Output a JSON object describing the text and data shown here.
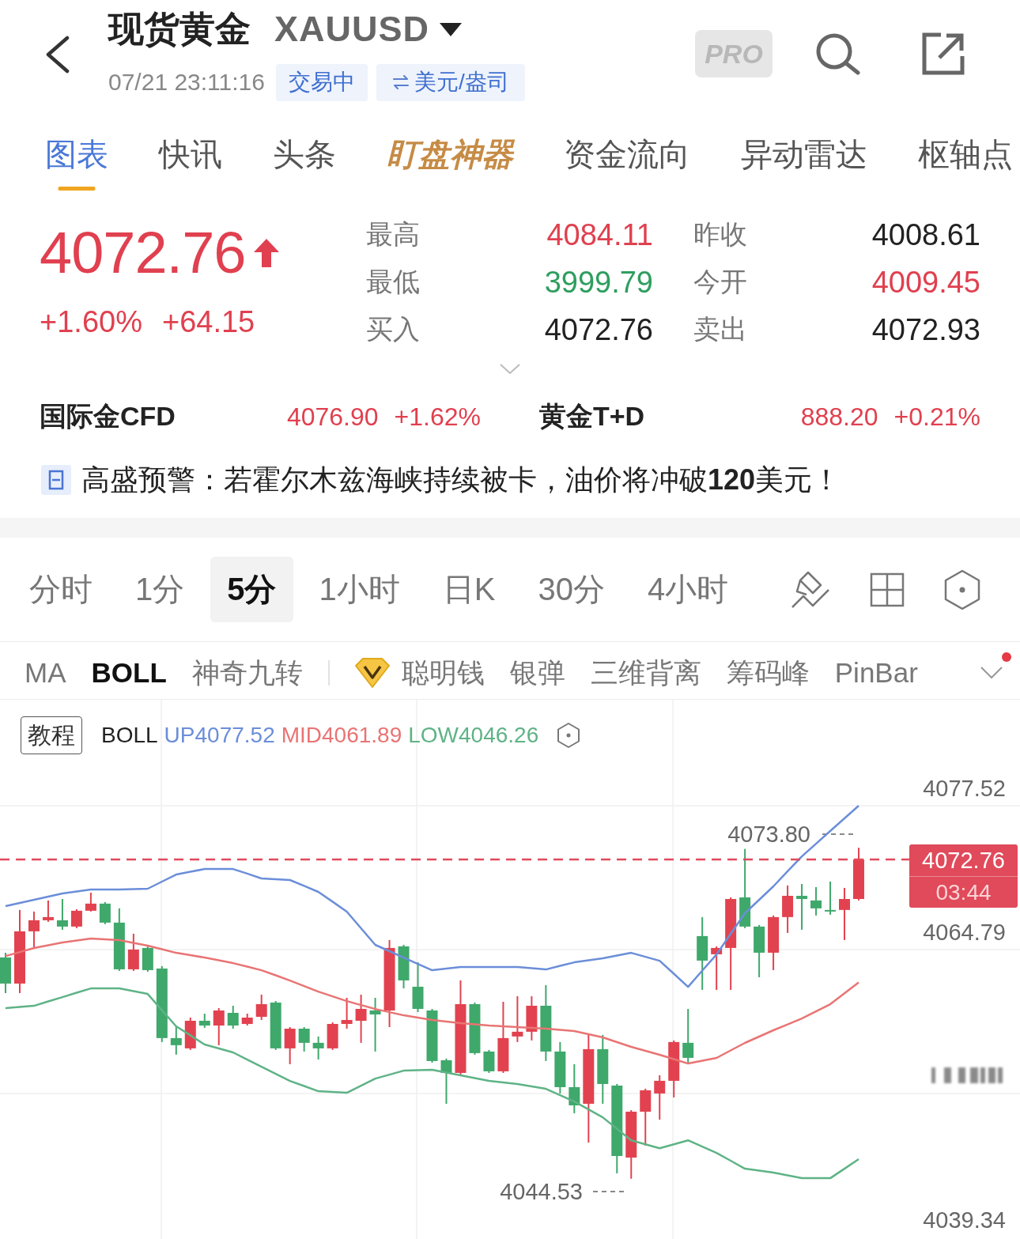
{
  "header": {
    "title": "现货黄金",
    "symbol": "XAUUSD",
    "time": "07/21 23:11:16",
    "badges": [
      {
        "kind": "status",
        "text": "交易中"
      },
      {
        "kind": "unit",
        "text": "美元/盎司"
      }
    ],
    "pro_label": "PRO"
  },
  "tabs": [
    {
      "label": "图表",
      "selected": true,
      "kind": "plain"
    },
    {
      "label": "快讯",
      "selected": false,
      "kind": "plain"
    },
    {
      "label": "头条",
      "selected": false,
      "kind": "plain"
    },
    {
      "label": "盯盘神器",
      "selected": false,
      "kind": "featured"
    },
    {
      "label": "资金流向",
      "selected": false,
      "kind": "plain"
    },
    {
      "label": "异动雷达",
      "selected": false,
      "kind": "plain"
    },
    {
      "label": "枢轴点",
      "selected": false,
      "kind": "plain"
    }
  ],
  "quote": {
    "price": "4072.76",
    "rising": true,
    "change_percent": "+1.60%",
    "change": "+64.15",
    "stats": [
      {
        "label": "最高",
        "value": "4084.11",
        "color": "#e0404f"
      },
      {
        "label": "昨收",
        "value": "4008.61",
        "color": "#222222"
      },
      {
        "label": "最低",
        "value": "3999.79",
        "color": "#2f9e5f"
      },
      {
        "label": "今开",
        "value": "4009.45",
        "color": "#e0404f"
      },
      {
        "label": "买入",
        "value": "4072.76",
        "color": "#222222"
      },
      {
        "label": "卖出",
        "value": "4072.93",
        "color": "#222222"
      }
    ]
  },
  "related": [
    {
      "name": "国际金CFD",
      "price": "4076.90",
      "change": "+1.62%",
      "color": "#e0404f"
    },
    {
      "name": "黄金T+D",
      "price": "888.20",
      "change": "+0.21%",
      "color": "#e0404f"
    }
  ],
  "news": {
    "text": "高盛预警：若霍尔木兹海峡持续被卡，油价将冲破**120**美元！"
  },
  "timeframes": [
    {
      "label": "分时",
      "selected": false
    },
    {
      "label": "1分",
      "selected": false
    },
    {
      "label": "5分",
      "selected": true
    },
    {
      "label": "1小时",
      "selected": false
    },
    {
      "label": "日K",
      "selected": false
    },
    {
      "label": "30分",
      "selected": false
    },
    {
      "label": "4小时",
      "selected": false
    }
  ],
  "indicators": {
    "basic": [
      {
        "label": "MA",
        "selected": false
      },
      {
        "label": "BOLL",
        "selected": true
      },
      {
        "label": "神奇九转",
        "selected": false
      }
    ],
    "premium": [
      {
        "label": "聪明钱",
        "selected": false
      },
      {
        "label": "银弹",
        "selected": false
      },
      {
        "label": "三维背离",
        "selected": false
      },
      {
        "label": "筹码峰",
        "selected": false
      },
      {
        "label": "PinBar",
        "selected": false
      }
    ],
    "more_alert": true
  },
  "chart": {
    "tutorial_label": "教程",
    "countdown": "03:44",
    "candles": {
      "chart_data": {
        "type": "candlestick",
        "grid": true,
        "ohlc": [
          [
            4064.1,
            4064.52,
            4060.95,
            4061.79
          ],
          [
            4061.79,
            4068.3,
            4060.95,
            4066.41
          ],
          [
            4066.41,
            4068.16,
            4064.94,
            4067.39
          ],
          [
            4067.39,
            4069.14,
            4067.25,
            4067.67
          ],
          [
            4067.39,
            4069.27,
            4066.55,
            4066.83
          ],
          [
            4066.83,
            4068.37,
            4066.69,
            4068.23
          ],
          [
            4068.23,
            4069.83,
            4068.16,
            4068.86
          ],
          [
            4068.86,
            4069.0,
            4067.04,
            4067.18
          ],
          [
            4067.18,
            4068.44,
            4062.91,
            4063.05
          ],
          [
            4063.05,
            4066.2,
            4062.91,
            4064.8
          ],
          [
            4064.94,
            4065.08,
            4062.84,
            4062.98
          ],
          [
            4063.12,
            4063.33,
            4056.62,
            4056.97
          ],
          [
            4056.97,
            4058.01,
            4055.5,
            4056.34
          ],
          [
            4056.06,
            4058.78,
            4055.92,
            4058.5
          ],
          [
            4058.5,
            4059.13,
            4057.87,
            4058.08
          ],
          [
            4058.08,
            4059.62,
            4056.34,
            4059.41
          ],
          [
            4059.2,
            4059.83,
            4057.8,
            4058.08
          ],
          [
            4058.22,
            4059.13,
            4058.08,
            4058.78
          ],
          [
            4058.85,
            4060.81,
            4058.57,
            4059.97
          ],
          [
            4060.11,
            4060.25,
            4055.92,
            4056.06
          ],
          [
            4056.06,
            4057.94,
            4054.66,
            4057.8
          ],
          [
            4057.8,
            4057.94,
            4055.78,
            4056.55
          ],
          [
            4056.55,
            4057.11,
            4055.08,
            4056.06
          ],
          [
            4056.06,
            4058.36,
            4055.92,
            4058.22
          ],
          [
            4058.22,
            4060.53,
            4057.8,
            4058.57
          ],
          [
            4058.5,
            4060.81,
            4056.55,
            4059.55
          ],
          [
            4059.41,
            4060.53,
            4055.78,
            4059.06
          ],
          [
            4059.41,
            4065.64,
            4057.94,
            4064.94
          ],
          [
            4065.08,
            4065.22,
            4061.37,
            4062.07
          ],
          [
            4061.51,
            4063.68,
            4059.27,
            4059.55
          ],
          [
            4059.41,
            4059.55,
            4054.8,
            4054.94
          ],
          [
            4055.01,
            4055.15,
            4051.16,
            4053.89
          ],
          [
            4053.89,
            4062.07,
            4053.75,
            4059.97
          ],
          [
            4059.97,
            4060.11,
            4055.5,
            4055.64
          ],
          [
            4055.78,
            4055.92,
            4053.89,
            4054.03
          ],
          [
            4054.03,
            4060.18,
            4053.89,
            4056.97
          ],
          [
            4057.11,
            4060.67,
            4056.62,
            4057.53
          ],
          [
            4057.53,
            4060.67,
            4056.76,
            4059.83
          ],
          [
            4059.83,
            4061.65,
            4054.94,
            4055.78
          ],
          [
            4055.78,
            4056.62,
            4052.07,
            4052.63
          ],
          [
            4052.63,
            4054.66,
            4050.32,
            4051.02
          ],
          [
            4051.16,
            4057.25,
            4047.73,
            4055.99
          ],
          [
            4055.99,
            4057.25,
            4051.16,
            4052.91
          ],
          [
            4052.77,
            4052.91,
            4045.01,
            4046.54
          ],
          [
            4046.4,
            4050.6,
            4044.53,
            4050.46
          ],
          [
            4050.46,
            4052.49,
            4047.45,
            4052.35
          ],
          [
            4052.07,
            4053.68,
            4049.76,
            4053.19
          ],
          [
            4053.19,
            4056.76,
            4051.72,
            4056.62
          ],
          [
            4056.55,
            4059.55,
            4054.66,
            4055.22
          ],
          [
            4065.99,
            4067.67,
            4061.23,
            4063.82
          ],
          [
            4064.38,
            4065.08,
            4061.23,
            4064.94
          ],
          [
            4064.94,
            4069.41,
            4061.23,
            4069.27
          ],
          [
            4069.41,
            4073.7,
            4066.69,
            4066.83
          ],
          [
            4066.83,
            4066.97,
            4062.35,
            4064.52
          ],
          [
            4064.52,
            4067.81,
            4062.98,
            4067.67
          ],
          [
            4067.67,
            4070.46,
            4066.27,
            4069.55
          ],
          [
            4069.55,
            4070.6,
            4066.55,
            4069.27
          ],
          [
            4069.14,
            4070.32,
            4067.81,
            4068.44
          ],
          [
            4068.3,
            4070.81,
            4067.88,
            4068.16
          ],
          [
            4068.3,
            4070.25,
            4065.64,
            4069.27
          ],
          [
            4069.27,
            4073.8,
            4069.14,
            4072.76
          ]
        ],
        "annotations": [
          "4073.80",
          "4044.53"
        ]
      }
    },
    "boll": {
      "indicator": "BOLL",
      "readings": [
        "4077.52",
        "4061.89",
        "4046.26"
      ],
      "chart_data": {
        "type": "line",
        "ylim": [
          4039.34,
          4077.52
        ],
        "yticks": [
          {
            "value": 4077.52,
            "label": "4077.52"
          },
          {
            "value": 4064.79,
            "label": "4064.79"
          },
          {
            "value": 4039.34,
            "label": "4039.34"
          }
        ],
        "series": [
          {
            "name": "UP",
            "color": "#6b8ed9",
            "values": [
              4068.64,
              4068.92,
              4069.2,
              4069.48,
              4069.76,
              4069.94,
              4070.11,
              4070.11,
              4070.11,
              4070.15,
              4070.18,
              4070.81,
              4071.43,
              4071.68,
              4071.92,
              4071.92,
              4071.92,
              4071.51,
              4071.09,
              4071.02,
              4070.95,
              4070.43,
              4069.9,
              4069.03,
              4068.15,
              4066.68,
              4065.21,
              4064.65,
              4064.09,
              4063.53,
              4062.97,
              4063.11,
              4063.25,
              4063.25,
              4063.25,
              4063.25,
              4063.25,
              4063.15,
              4063.04,
              4063.36,
              4063.67,
              4063.85,
              4064.02,
              4064.27,
              4064.51,
              4064.16,
              4063.81,
              4062.66,
              4061.5,
              4062.94,
              4064.37,
              4066.19,
              4068.01,
              4069.2,
              4070.39,
              4071.72,
              4073.04,
              4074.16,
              4075.28,
              4076.4,
              4077.52
            ]
          },
          {
            "name": "MID",
            "color": "#e97474",
            "values": [
              4064.23,
              4064.58,
              4064.93,
              4065.18,
              4065.42,
              4065.6,
              4065.77,
              4065.7,
              4065.63,
              4065.39,
              4065.14,
              4064.83,
              4064.51,
              4064.3,
              4064.09,
              4063.85,
              4063.6,
              4063.29,
              4062.97,
              4062.52,
              4062.06,
              4061.57,
              4061.08,
              4060.66,
              4060.24,
              4059.89,
              4059.54,
              4059.26,
              4058.98,
              4058.78,
              4058.57,
              4058.43,
              4058.29,
              4058.19,
              4058.08,
              4058.01,
              4057.94,
              4057.87,
              4057.8,
              4057.7,
              4057.59,
              4057.31,
              4057.03,
              4056.61,
              4056.19,
              4055.84,
              4055.49,
              4055.11,
              4054.72,
              4054.97,
              4055.21,
              4055.88,
              4056.54,
              4057.1,
              4057.66,
              4058.18,
              4058.7,
              4059.33,
              4059.96,
              4060.93,
              4061.89
            ]
          },
          {
            "name": "LOW",
            "color": "#5fb386",
            "values": [
              4059.61,
              4059.72,
              4059.82,
              4060.21,
              4060.59,
              4060.98,
              4061.36,
              4061.36,
              4061.36,
              4061.12,
              4060.87,
              4059.44,
              4058.01,
              4057.21,
              4056.4,
              4056.05,
              4055.7,
              4055.07,
              4054.44,
              4053.81,
              4053.18,
              4052.73,
              4052.27,
              4052.2,
              4052.13,
              4052.76,
              4053.39,
              4053.74,
              4054.09,
              4054.13,
              4054.16,
              4053.92,
              4053.67,
              4053.43,
              4053.18,
              4053.04,
              4052.9,
              4052.69,
              4052.48,
              4051.92,
              4051.36,
              4050.66,
              4049.96,
              4048.95,
              4047.93,
              4047.58,
              4047.23,
              4047.58,
              4047.93,
              4047.37,
              4046.81,
              4046.12,
              4045.42,
              4045.25,
              4045.07,
              4044.83,
              4044.58,
              4044.58,
              4044.58,
              4045.42,
              4046.26
            ]
          }
        ],
        "ref_lines": [
          {
            "axis": "y",
            "value": 4072.76,
            "label": "4072.76",
            "color": "#e04a5a"
          }
        ]
      }
    }
  }
}
